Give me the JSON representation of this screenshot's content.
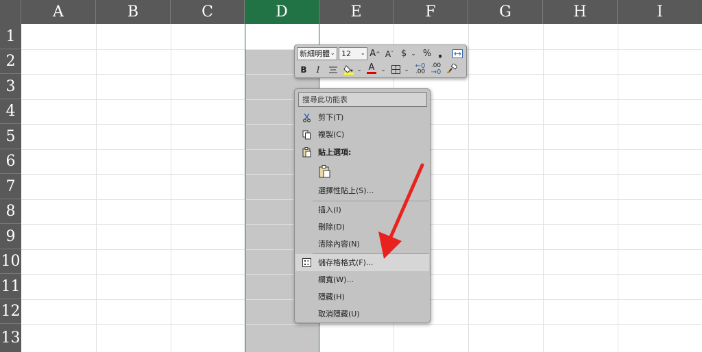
{
  "sheet": {
    "columns": [
      "A",
      "B",
      "C",
      "D",
      "E",
      "F",
      "G",
      "H",
      "I"
    ],
    "rows": [
      "1",
      "2",
      "3",
      "4",
      "5",
      "6",
      "7",
      "8",
      "9",
      "10",
      "11",
      "12",
      "13"
    ],
    "selected_column": "D",
    "selected_column_color": "#217346",
    "header_color": "#595959"
  },
  "mini_toolbar": {
    "font_name": "新細明體",
    "font_size": "12",
    "grow_font": "A",
    "shrink_font": "A",
    "currency": "$",
    "percent": "%",
    "comma": "❟",
    "bold": "B",
    "italic": "I",
    "font_color": "A",
    "increase_decimal": ".00",
    "decrease_decimal": ".00",
    "fill_color_hex": "#ffff00",
    "font_color_hex": "#e00000"
  },
  "context_menu": {
    "search_placeholder": "搜尋此功能表",
    "items": [
      {
        "label": "剪下(T)",
        "icon": "scissors-icon"
      },
      {
        "label": "複製(C)",
        "icon": "copy-icon"
      },
      {
        "label": "貼上選項:",
        "icon": "paste-icon"
      },
      {
        "label": "選擇性貼上(S)..."
      },
      {
        "label": "插入(I)"
      },
      {
        "label": "刪除(D)"
      },
      {
        "label": "清除內容(N)"
      },
      {
        "label": "儲存格格式(F)...",
        "icon": "format-cells-icon"
      },
      {
        "label": "欄寬(W)..."
      },
      {
        "label": "隱藏(H)"
      },
      {
        "label": "取消隱藏(U)"
      }
    ]
  },
  "annotation": {
    "arrow_color": "#e8231f"
  }
}
